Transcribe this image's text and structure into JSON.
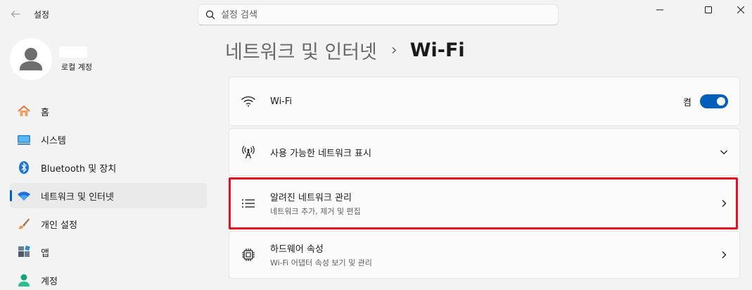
{
  "window": {
    "title": "설정"
  },
  "search": {
    "placeholder": "설정 검색"
  },
  "profile": {
    "account_type": "로컬 계정"
  },
  "sidebar": {
    "items": [
      {
        "label": "홈",
        "icon": "home-icon"
      },
      {
        "label": "시스템",
        "icon": "system-icon"
      },
      {
        "label": "Bluetooth 및 장치",
        "icon": "bluetooth-icon"
      },
      {
        "label": "네트워크 및 인터넷",
        "icon": "network-wifi-icon",
        "active": true
      },
      {
        "label": "개인 설정",
        "icon": "brush-icon"
      },
      {
        "label": "앱",
        "icon": "apps-icon"
      },
      {
        "label": "계정",
        "icon": "account-icon"
      }
    ]
  },
  "breadcrumb": {
    "parent": "네트워크 및 인터넷",
    "separator": "›",
    "current": "Wi-Fi"
  },
  "cards": {
    "wifi": {
      "title": "Wi-Fi",
      "toggle_label": "켬",
      "toggle_on": true
    },
    "available": {
      "title": "사용 가능한 네트워크 표시"
    },
    "known": {
      "title": "알려진 네트워크 관리",
      "subtitle": "네트워크 추가, 제거 및 편집"
    },
    "hardware": {
      "title": "하드웨어 속성",
      "subtitle": "Wi-Fi 어댑터 속성 보기 및 관리"
    }
  },
  "colors": {
    "accent": "#005fb8",
    "highlight": "#e81123"
  }
}
